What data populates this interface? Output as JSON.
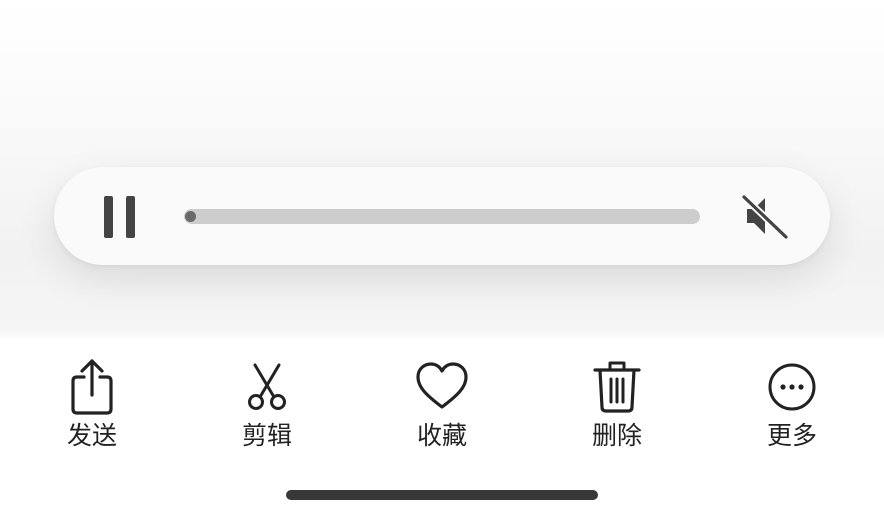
{
  "player": {
    "state": "paused",
    "progress": 0.0,
    "muted": true,
    "pause_icon": "pause-icon",
    "mute_icon": "speaker-muted-icon"
  },
  "toolbar": {
    "items": [
      {
        "label": "发送",
        "icon": "share-icon"
      },
      {
        "label": "剪辑",
        "icon": "scissors-icon"
      },
      {
        "label": "收藏",
        "icon": "heart-icon"
      },
      {
        "label": "删除",
        "icon": "trash-icon"
      },
      {
        "label": "更多",
        "icon": "more-icon"
      }
    ]
  },
  "colors": {
    "icon": "#222222",
    "track": "#cdcdcd",
    "knob": "#6a6a6a",
    "home_indicator": "#383838"
  }
}
